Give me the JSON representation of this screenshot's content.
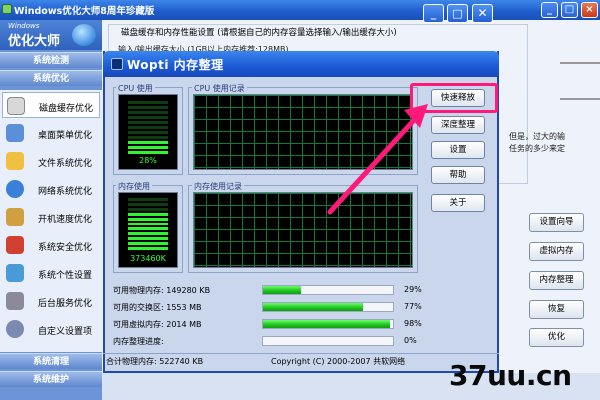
{
  "main_window": {
    "title": "Windows优化大师8周年珍藏版",
    "min_glyph": "_",
    "max_glyph": "□",
    "close_glyph": "×"
  },
  "sidebar": {
    "logo_small": "Windows",
    "logo_big": "优化大师",
    "categories": {
      "check": "系统检测",
      "optimize": "系统优化",
      "clean": "系统清理",
      "maintain": "系统维护"
    },
    "items": [
      {
        "label": "磁盘缓存优化",
        "icon": "disk-icon",
        "color": "#e0e0e0"
      },
      {
        "label": "桌面菜单优化",
        "icon": "desktop-icon",
        "color": "#5b8fd8"
      },
      {
        "label": "文件系统优化",
        "icon": "folder-icon",
        "color": "#f0c040"
      },
      {
        "label": "网络系统优化",
        "icon": "globe-icon",
        "color": "#3a7fd8"
      },
      {
        "label": "开机速度优化",
        "icon": "wrench-icon",
        "color": "#d0a040"
      },
      {
        "label": "系统安全优化",
        "icon": "shield-icon",
        "color": "#d04030"
      },
      {
        "label": "系统个性设置",
        "icon": "users-icon",
        "color": "#4a9ad8"
      },
      {
        "label": "后台服务优化",
        "icon": "server-icon",
        "color": "#8a8a9a"
      },
      {
        "label": "自定义设置项",
        "icon": "gear-icon",
        "color": "#7a8ab0"
      }
    ]
  },
  "background": {
    "group_title": "磁盘缓存和内存性能设置 (请根据自己的内存容量选择输入/输出缓存大小)",
    "line1": "输入/输出缓存大小 (1GB以上内存推荐:128MB)",
    "line2": "但是，过大的输",
    "line3": "任务的多少来定",
    "buttons": {
      "wizard": "设置向导",
      "virtual": "虚拟内存",
      "memory": "内存整理",
      "restore": "恢复",
      "optimize": "优化"
    }
  },
  "dialog": {
    "title": "Wopti 内存整理",
    "min_glyph": "_",
    "max_glyph": "□",
    "close_glyph": "✕",
    "cpu_usage_label": "CPU 使用",
    "cpu_history_label": "CPU 使用记录",
    "mem_usage_label": "内存使用",
    "mem_history_label": "内存使用记录",
    "cpu_value": "28%",
    "cpu_fraction": 0.28,
    "mem_value": "373460K",
    "mem_fraction": 0.71,
    "buttons": {
      "quick_release": "快速释放",
      "deep_clean": "深度整理",
      "settings": "设置",
      "help": "帮助",
      "about": "关于"
    },
    "stats": [
      {
        "label": "可用物理内存: 149280 KB",
        "value": "29%",
        "fraction": 0.29
      },
      {
        "label": "可用的交换区: 1553 MB",
        "value": "77%",
        "fraction": 0.77
      },
      {
        "label": "可用虚拟内存: 2014 MB",
        "value": "98%",
        "fraction": 0.98
      },
      {
        "label": "内存整理进度:",
        "value": "0%",
        "fraction": 0.0
      }
    ],
    "status_total": "合计物理内存: 522740 KB",
    "status_copyright": "Copyright (C) 2000-2007 共软网络"
  },
  "overlay": {
    "highlight_color": "#ff1a7a",
    "watermark": "37uu.cn"
  }
}
